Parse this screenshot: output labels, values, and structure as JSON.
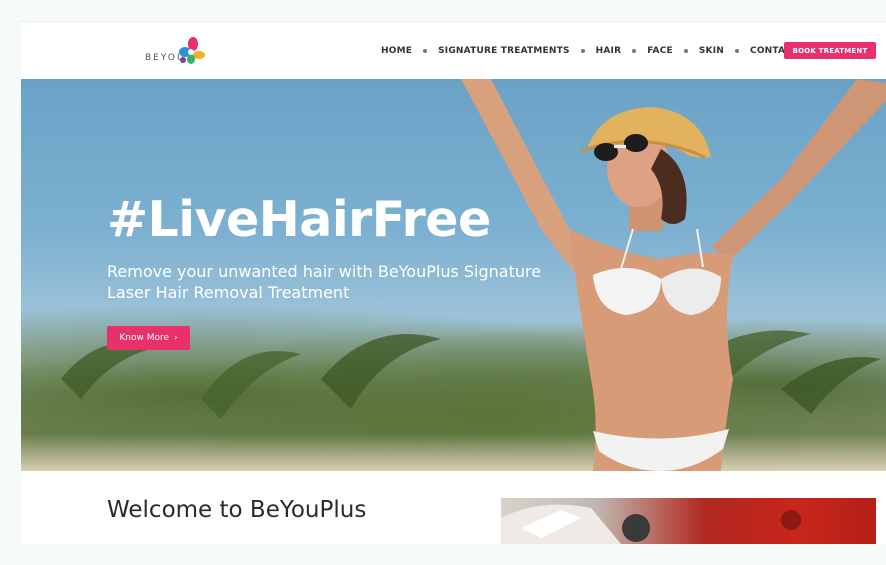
{
  "logo": {
    "text": "BEYOU"
  },
  "nav": {
    "items": [
      {
        "label": "HOME",
        "name": "nav-home"
      },
      {
        "label": "SIGNATURE TREATMENTS",
        "name": "nav-signature-treatments"
      },
      {
        "label": "HAIR",
        "name": "nav-hair"
      },
      {
        "label": "FACE",
        "name": "nav-face"
      },
      {
        "label": "SKIN",
        "name": "nav-skin"
      },
      {
        "label": "CONTACT",
        "name": "nav-contact"
      }
    ],
    "book_label": "BOOK TREATMENT"
  },
  "hero": {
    "title": "#LiveHairFree",
    "subtitle": "Remove your unwanted hair with BeYouPlus Signature Laser Hair Removal Treatment",
    "button_label": "Know More",
    "button_icon": "chevron-right-icon"
  },
  "welcome": {
    "title": "Welcome to BeYouPlus"
  },
  "colors": {
    "accent": "#e8306a",
    "background": "#f4fbfa",
    "text": "#2a2a2a"
  }
}
